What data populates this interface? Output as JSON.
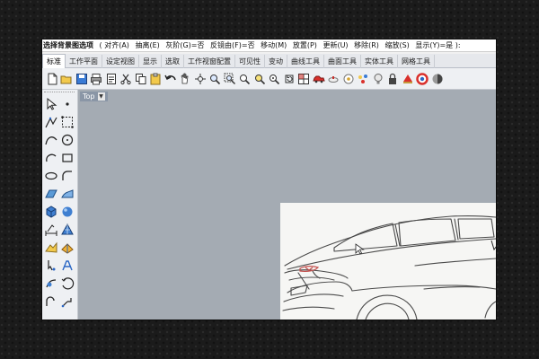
{
  "command_line": {
    "command": "选择背景图选项",
    "options": [
      "( 对齐(A)",
      "抽离(E)",
      "灰阶(G)=否",
      "反镜由(F)=否",
      "移动(M)",
      "放置(P)",
      "更新(U)",
      "移除(R)",
      "缩放(S)",
      "显示(Y)=是 ):"
    ]
  },
  "tabs": [
    {
      "label": "标准",
      "active": true
    },
    {
      "label": "工作平面",
      "active": false
    },
    {
      "label": "设定视图",
      "active": false
    },
    {
      "label": "显示",
      "active": false
    },
    {
      "label": "选取",
      "active": false
    },
    {
      "label": "工作视窗配置",
      "active": false
    },
    {
      "label": "可见性",
      "active": false
    },
    {
      "label": "变动",
      "active": false
    },
    {
      "label": "曲线工具",
      "active": false
    },
    {
      "label": "曲面工具",
      "active": false
    },
    {
      "label": "实体工具",
      "active": false
    },
    {
      "label": "网格工具",
      "active": false
    }
  ],
  "toolbar_icons": [
    "new-file-icon",
    "open-folder-icon",
    "save-icon",
    "print-icon",
    "properties-icon",
    "cut-icon",
    "copy-icon",
    "paste-icon",
    "undo-icon",
    "pan-hand-icon",
    "rotate-view-icon",
    "zoom-icon",
    "zoom-window-icon",
    "zoom-extents-icon",
    "zoom-selected-icon",
    "zoom-target-icon",
    "undo-view-icon",
    "four-viewports-icon",
    "car-render-icon",
    "lamp-render-icon",
    "point-on-icon",
    "snap-icon",
    "bulb-icon",
    "lock-icon",
    "material-icon",
    "color-wheel-icon",
    "sphere-render-icon"
  ],
  "side_icons": [
    "select-arrow-icon",
    "point-icon",
    "polyline-icon",
    "box-select-icon",
    "curve-icon",
    "circle-icon",
    "arc-icon",
    "rectangle-icon",
    "ellipse-icon",
    "fillet-icon",
    "surface-icon",
    "surface-edit-icon",
    "solid-box-icon",
    "solid-sphere-icon",
    "dimension-icon",
    "mesh-icon",
    "fold-icon",
    "bend-icon",
    "point-edit-icon",
    "text-icon",
    "blend-icon",
    "rotate-icon",
    "curve2-icon",
    "transform-icon"
  ],
  "viewport": {
    "label": "Top",
    "dropdown": "▼"
  },
  "colors": {
    "viewport_bg": "#a4abb3",
    "accent": "#2a66c4"
  }
}
